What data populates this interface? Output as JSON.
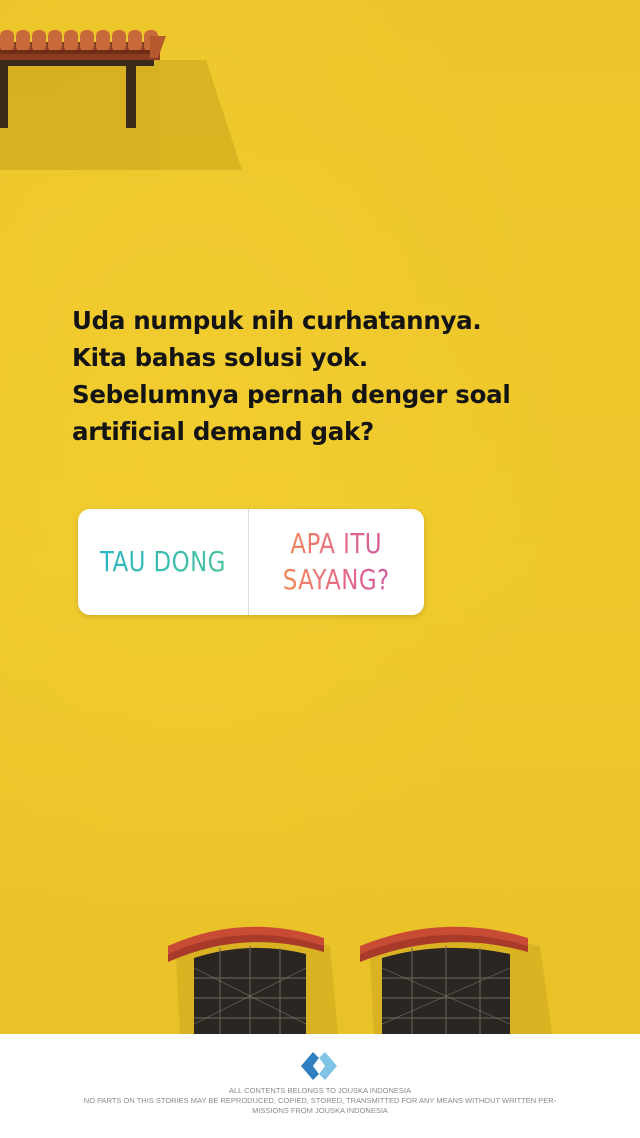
{
  "story": {
    "question_lines": [
      "Uda numpuk nih curhatannya.",
      "Kita bahas solusi yok.",
      "Sebelumnya pernah denger soal",
      "artificial demand gak?"
    ],
    "quiz": {
      "option_a": "TAU DONG",
      "option_b_line1": "APA ITU",
      "option_b_line2": "SAYANG?"
    }
  },
  "footer": {
    "logo_icon": "jouska-logo-icon",
    "line1": "ALL CONTENTS BELONGS TO JOUSKA INDONESIA",
    "line2": "NO PARTS ON THIS STORIES MAY BE REPRODUCED, COPIED, STORED, TRANSMITTED FOR ANY MEANS WITHOUT WRITTEN PER-",
    "line3": "MISSIONS FROM JOUSKA INDONESIA"
  },
  "colors": {
    "wall": "#eec72a",
    "text": "#141414",
    "option_a_gradient": [
      "#2bb5c5",
      "#4cc39f"
    ],
    "option_b_gradient": [
      "#f08a55",
      "#e86a86",
      "#d0579f"
    ]
  }
}
